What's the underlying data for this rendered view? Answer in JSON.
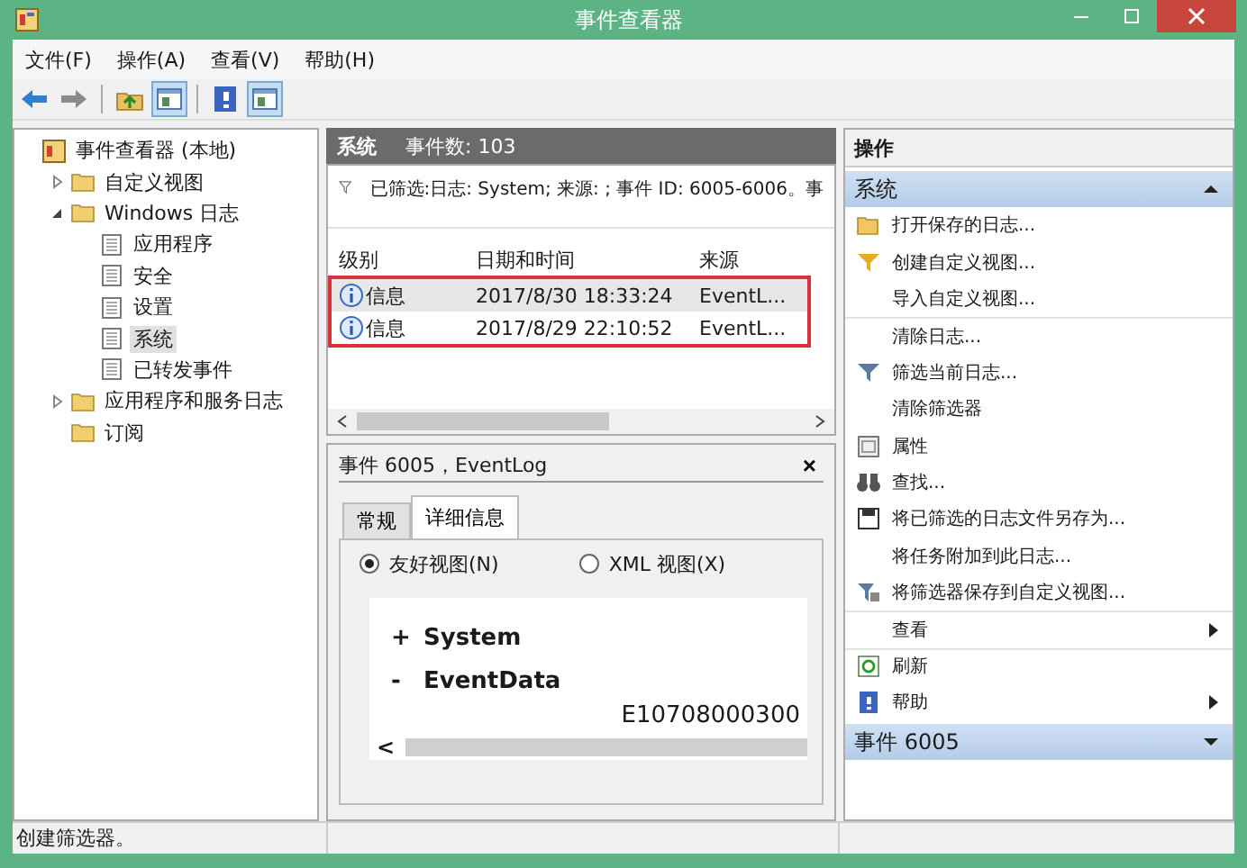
{
  "window": {
    "title": "事件查看器"
  },
  "menu": [
    "文件(F)",
    "操作(A)",
    "查看(V)",
    "帮助(H)"
  ],
  "toolbar": [
    {
      "kind": "back",
      "pressed": false
    },
    {
      "kind": "forward",
      "pressed": false
    },
    {
      "kind": "sep"
    },
    {
      "kind": "up",
      "pressed": false
    },
    {
      "kind": "pane",
      "pressed": true
    },
    {
      "kind": "sep"
    },
    {
      "kind": "help",
      "pressed": false
    },
    {
      "kind": "pane",
      "pressed": true
    }
  ],
  "tree": [
    {
      "label": "事件查看器 (本地)",
      "kind": "root",
      "selected": false,
      "children": [
        {
          "label": "自定义视图",
          "kind": "folder",
          "selected": false,
          "expanded": false
        },
        {
          "label": "Windows 日志",
          "kind": "folder",
          "selected": false,
          "expanded": true,
          "children": [
            {
              "label": "应用程序",
              "kind": "log",
              "selected": false
            },
            {
              "label": "安全",
              "kind": "log",
              "selected": false
            },
            {
              "label": "设置",
              "kind": "log",
              "selected": false
            },
            {
              "label": "系统",
              "kind": "log",
              "selected": true
            },
            {
              "label": "已转发事件",
              "kind": "log",
              "selected": false
            }
          ]
        },
        {
          "label": "应用程序和服务日志",
          "kind": "folder",
          "selected": false,
          "expanded": false
        },
        {
          "label": "订阅",
          "kind": "folder",
          "selected": false
        }
      ]
    }
  ],
  "log_header": {
    "name": "系统",
    "count": "事件数: 103"
  },
  "filter_text": "已筛选:日志: System; 来源: ; 事件 ID: 6005-6006。事",
  "table": {
    "columns": [
      "级别",
      "日期和时间",
      "来源"
    ],
    "rows": [
      {
        "level": "信息",
        "date": "2017/8/30 18:33:24",
        "source": "EventL...",
        "selected": true
      },
      {
        "level": "信息",
        "date": "2017/8/29 22:10:52",
        "source": "EventL...",
        "selected": false
      }
    ]
  },
  "detail": {
    "title": "事件 6005，EventLog",
    "close": "×",
    "tabs": [
      {
        "label": "常规",
        "selected": false
      },
      {
        "label": "详细信息",
        "selected": true
      }
    ],
    "views": [
      {
        "label": "友好视图(N)",
        "selected": true
      },
      {
        "label": "XML 视图(X)",
        "selected": false
      }
    ],
    "tree": [
      {
        "sign": "+",
        "label": "System"
      },
      {
        "sign": "-",
        "label": "EventData"
      }
    ],
    "value": "E10708000300",
    "scroll_left": "<"
  },
  "actions": {
    "title": "操作",
    "sections": [
      {
        "title": "系统",
        "expanded": true,
        "items": [
          {
            "label": "打开保存的日志...",
            "separator_before": false,
            "submenu": false
          },
          {
            "label": "创建自定义视图...",
            "separator_before": false,
            "submenu": false
          },
          {
            "label": "导入自定义视图...",
            "separator_before": false,
            "submenu": false
          },
          {
            "label": "清除日志...",
            "separator_before": true,
            "submenu": false
          },
          {
            "label": "筛选当前日志...",
            "separator_before": false,
            "submenu": false
          },
          {
            "label": "清除筛选器",
            "separator_before": false,
            "submenu": false
          },
          {
            "label": "属性",
            "separator_before": false,
            "submenu": false
          },
          {
            "label": "查找...",
            "separator_before": false,
            "submenu": false
          },
          {
            "label": "将已筛选的日志文件另存为...",
            "separator_before": false,
            "submenu": false
          },
          {
            "label": "将任务附加到此日志...",
            "separator_before": false,
            "submenu": false
          },
          {
            "label": "将筛选器保存到自定义视图...",
            "separator_before": false,
            "submenu": false
          },
          {
            "label": "查看",
            "separator_before": true,
            "submenu": true
          },
          {
            "label": "刷新",
            "separator_before": true,
            "submenu": false
          },
          {
            "label": "帮助",
            "separator_before": false,
            "submenu": true
          }
        ]
      },
      {
        "title": "事件 6005",
        "expanded": false
      }
    ]
  },
  "status_bar": "创建筛选器。"
}
